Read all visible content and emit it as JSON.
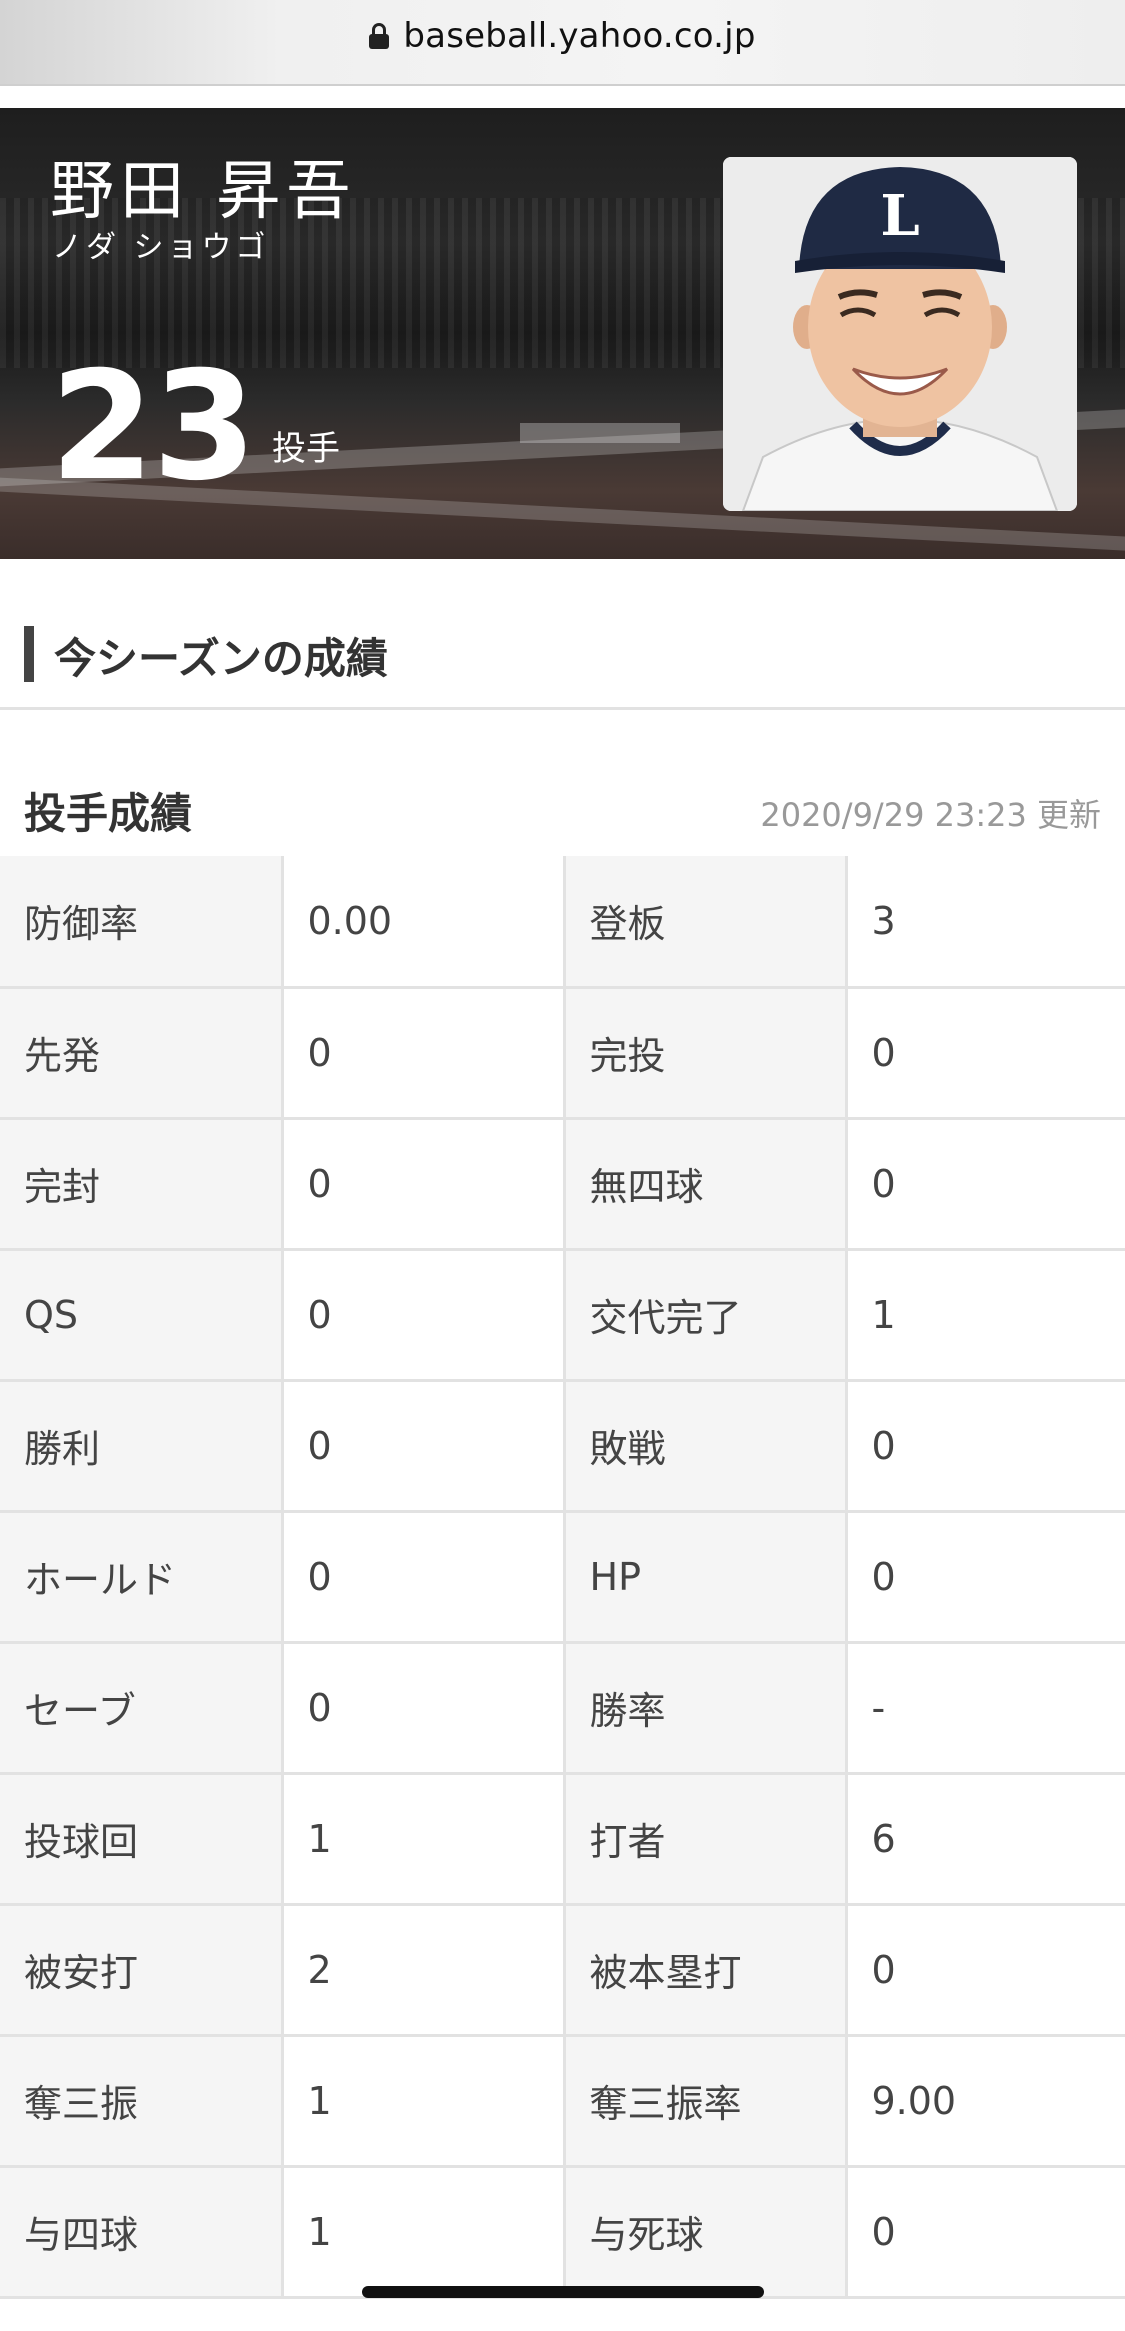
{
  "browser": {
    "url": "baseball.yahoo.co.jp"
  },
  "player": {
    "name": "野田 昇吾",
    "kana": "ノダ ショウゴ",
    "number": "23",
    "position": "投手",
    "photo_icon": "player-photo"
  },
  "season": {
    "title": "今シーズンの成績"
  },
  "pitching": {
    "title": "投手成績",
    "updated": "2020/9/29 23:23 更新",
    "rows": [
      [
        {
          "label": "防御率",
          "value": "0.00"
        },
        {
          "label": "登板",
          "value": "3"
        }
      ],
      [
        {
          "label": "先発",
          "value": "0"
        },
        {
          "label": "完投",
          "value": "0"
        }
      ],
      [
        {
          "label": "完封",
          "value": "0"
        },
        {
          "label": "無四球",
          "value": "0"
        }
      ],
      [
        {
          "label": "QS",
          "value": "0"
        },
        {
          "label": "交代完了",
          "value": "1"
        }
      ],
      [
        {
          "label": "勝利",
          "value": "0"
        },
        {
          "label": "敗戦",
          "value": "0"
        }
      ],
      [
        {
          "label": "ホールド",
          "value": "0"
        },
        {
          "label": "HP",
          "value": "0"
        }
      ],
      [
        {
          "label": "セーブ",
          "value": "0"
        },
        {
          "label": "勝率",
          "value": "-"
        }
      ],
      [
        {
          "label": "投球回",
          "value": "1"
        },
        {
          "label": "打者",
          "value": "6"
        }
      ],
      [
        {
          "label": "被安打",
          "value": "2"
        },
        {
          "label": "被本塁打",
          "value": "0"
        }
      ],
      [
        {
          "label": "奪三振",
          "value": "1"
        },
        {
          "label": "奪三振率",
          "value": "9.00"
        }
      ],
      [
        {
          "label": "与四球",
          "value": "1"
        },
        {
          "label": "与死球",
          "value": "0"
        }
      ]
    ]
  }
}
